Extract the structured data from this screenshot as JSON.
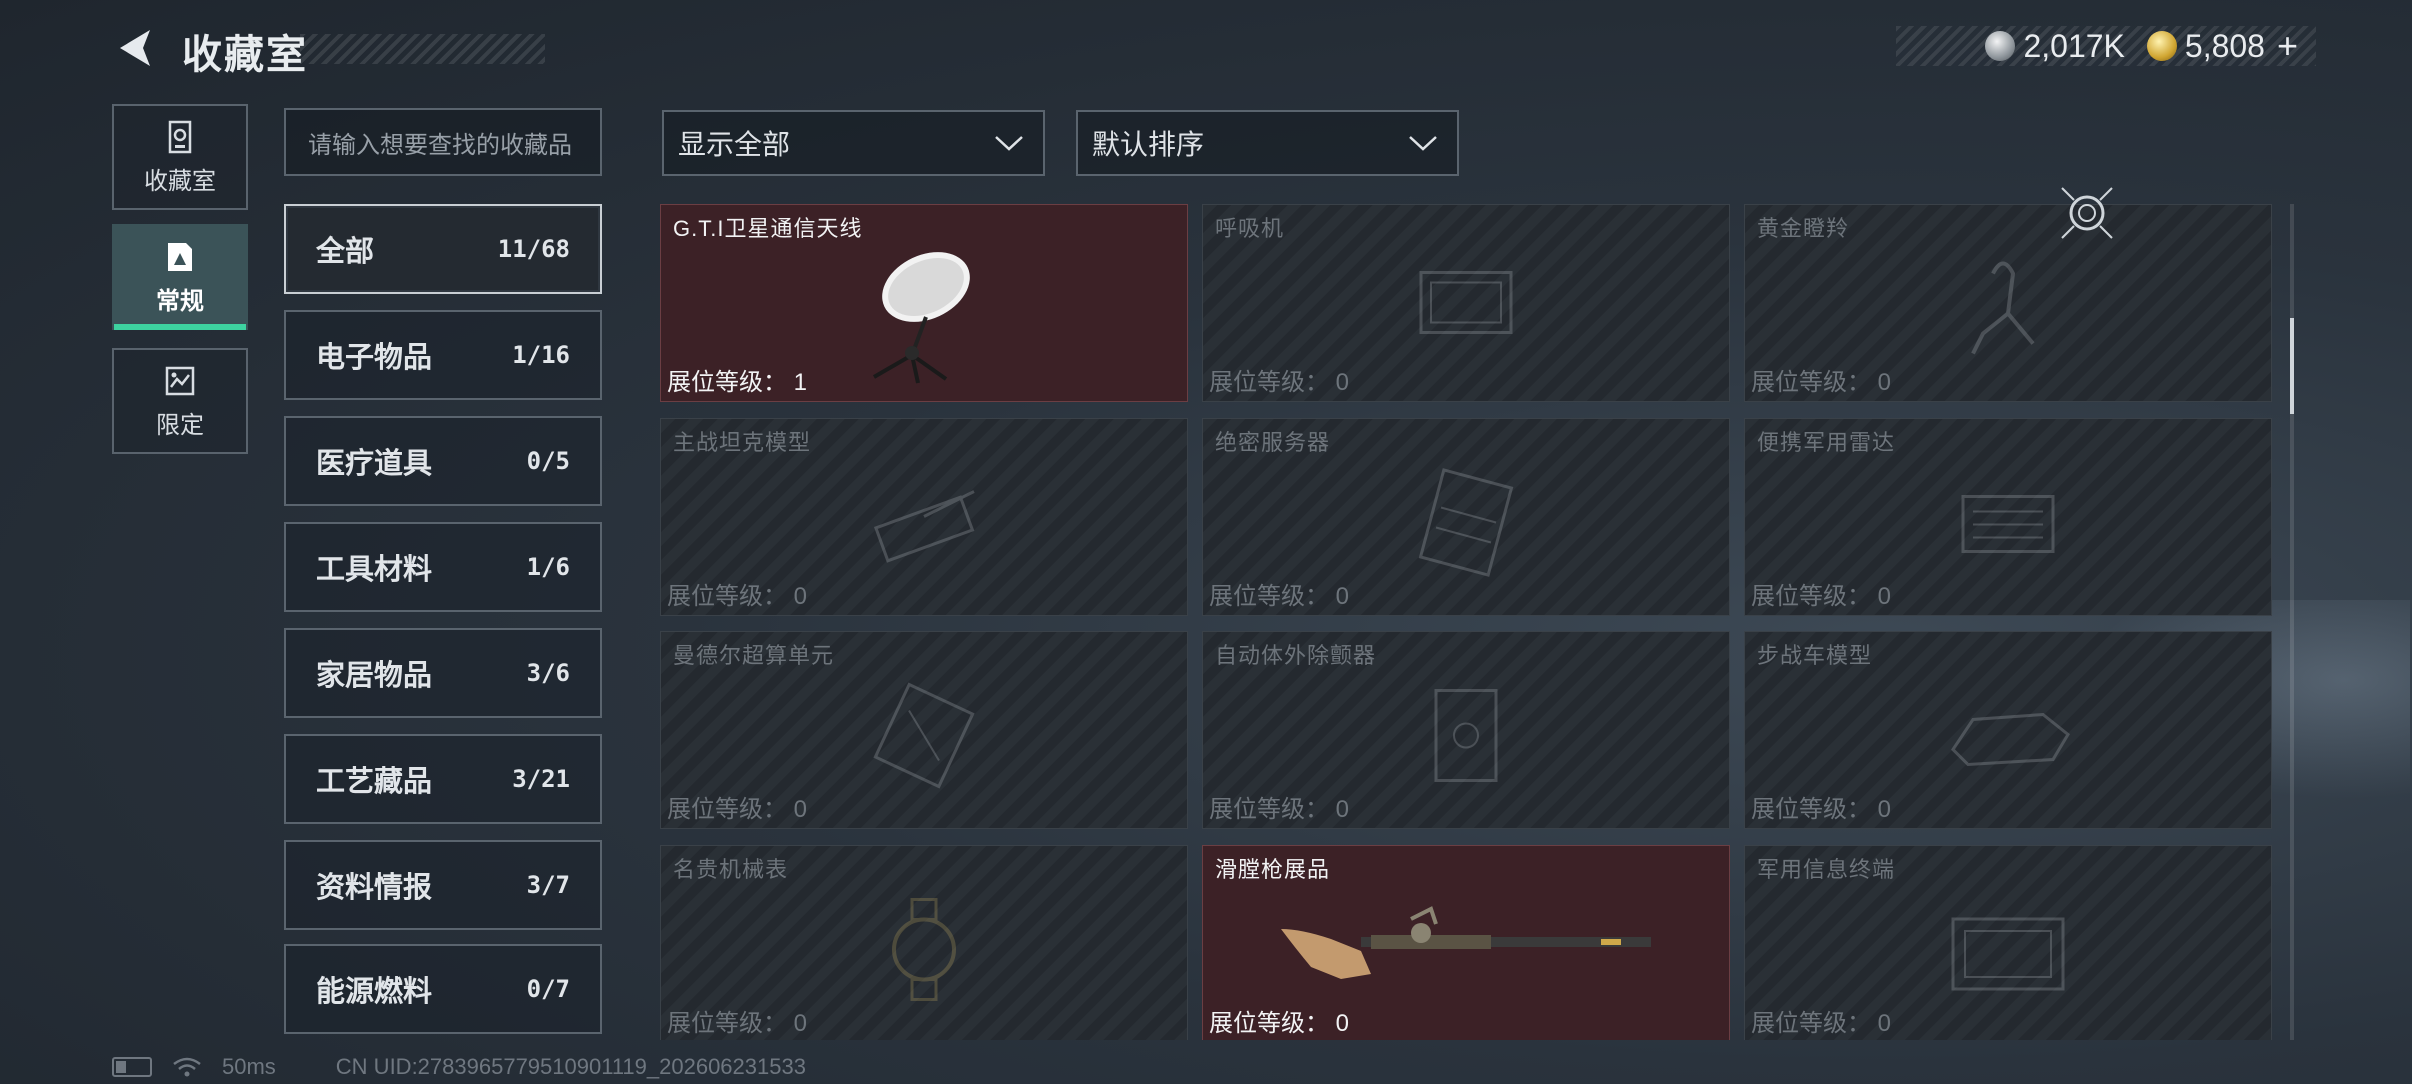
{
  "header": {
    "title": "收藏室",
    "currency": [
      {
        "icon": "silver-coin-icon",
        "value": "2,017K"
      },
      {
        "icon": "gold-coin-icon",
        "value": "5,808"
      }
    ],
    "add_label": "+"
  },
  "nav": [
    {
      "label": "收藏室",
      "icon": "vault-icon",
      "active": false
    },
    {
      "label": "常规",
      "icon": "regular-collection-icon",
      "active": true
    },
    {
      "label": "限定",
      "icon": "limited-collection-icon",
      "active": false
    }
  ],
  "search": {
    "placeholder": "请输入想要查找的收藏品"
  },
  "categories": [
    {
      "label": "全部",
      "count": "11/68",
      "active": true
    },
    {
      "label": "电子物品",
      "count": "1/16"
    },
    {
      "label": "医疗道具",
      "count": "0/5"
    },
    {
      "label": "工具材料",
      "count": "1/6"
    },
    {
      "label": "家居物品",
      "count": "3/6"
    },
    {
      "label": "工艺藏品",
      "count": "3/21"
    },
    {
      "label": "资料情报",
      "count": "3/7"
    },
    {
      "label": "能源燃料",
      "count": "0/7"
    }
  ],
  "filters": {
    "display": "显示全部",
    "sort": "默认排序"
  },
  "level_label": "展位等级：",
  "items": [
    {
      "name": "G.T.I卫星通信天线",
      "level": "1",
      "owned": true
    },
    {
      "name": "呼吸机",
      "level": "0",
      "owned": false
    },
    {
      "name": "黄金瞪羚",
      "level": "0",
      "owned": false
    },
    {
      "name": "主战坦克模型",
      "level": "0",
      "owned": false
    },
    {
      "name": "绝密服务器",
      "level": "0",
      "owned": false
    },
    {
      "name": "便携军用雷达",
      "level": "0",
      "owned": false
    },
    {
      "name": "曼德尔超算单元",
      "level": "0",
      "owned": false
    },
    {
      "name": "自动体外除颤器",
      "level": "0",
      "owned": false
    },
    {
      "name": "步战车模型",
      "level": "0",
      "owned": false
    },
    {
      "name": "名贵机械表",
      "level": "0",
      "owned": false
    },
    {
      "name": "滑膛枪展品",
      "level": "0",
      "owned": true
    },
    {
      "name": "军用信息终端",
      "level": "0",
      "owned": false
    }
  ],
  "footer": {
    "ping": "50ms",
    "uid": "CN UID:2783965779510901119_202606231533"
  },
  "colors": {
    "accent": "#3dd3a0",
    "owned_card": "#3c2126",
    "background": "#2a333d"
  }
}
